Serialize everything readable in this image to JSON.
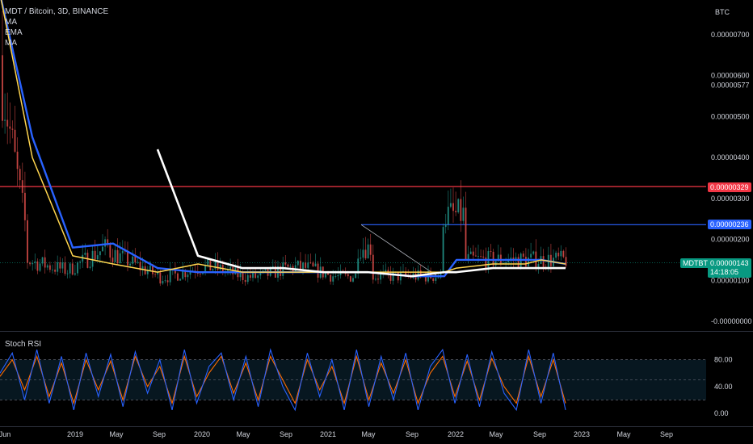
{
  "header": {
    "symbol_line": "MDT / Bitcoin, 3D, BINANCE",
    "indicators": [
      "MA",
      "EMA",
      "MA"
    ]
  },
  "currency": "BTC",
  "price_axis": {
    "ticks": [
      "0.00000700",
      "0.00000600",
      "0.00000577",
      "0.00000500",
      "0.00000400",
      "0.00000300",
      "0.00000200",
      "0.00000100",
      "-0.00000000"
    ]
  },
  "tags": {
    "red_level": "0.00000329",
    "blue_level": "0.00000236",
    "last_symbol": "MDTBTC",
    "last_price": "0.00000143",
    "countdown": "14:18:05"
  },
  "time_axis": {
    "labels": [
      "Jun",
      "2019",
      "May",
      "Sep",
      "2020",
      "May",
      "Sep",
      "2021",
      "May",
      "Sep",
      "2022",
      "May",
      "Sep",
      "2023",
      "May",
      "Sep"
    ]
  },
  "stoch": {
    "title": "Stoch RSI",
    "ticks": [
      "80.00",
      "40.00",
      "0.00"
    ]
  },
  "colors": {
    "background": "#000000",
    "red_line": "#f23645",
    "blue_line": "#2962ff",
    "ma_blue": "#2962ff",
    "ema_yellow": "#ffd54f",
    "ma_white": "#ffffff",
    "candle_up": "#26a69a",
    "candle_down": "#ef5350",
    "last_price_tag": "#089981",
    "stoch_k": "#2962ff",
    "stoch_d": "#ff6d00",
    "stoch_band": "#0d2a3a"
  },
  "chart_data": [
    {
      "type": "line",
      "title": "MDT / Bitcoin, 3D, BINANCE",
      "ylabel": "BTC",
      "ylim": [
        0,
        7.5e-06
      ],
      "horizontal_levels": [
        3.29e-06,
        2.36e-06
      ],
      "last_price": 1.43e-06,
      "x": [
        "2018-06",
        "2018-09",
        "2019-01",
        "2019-05",
        "2019-09",
        "2020-01",
        "2020-05",
        "2020-09",
        "2021-01",
        "2021-04",
        "2021-05",
        "2021-09",
        "2021-12",
        "2022-01",
        "2022-05",
        "2022-08",
        "2022-09",
        "2022-11"
      ],
      "series": [
        {
          "name": "MA",
          "values": [
            8e-06,
            4.5e-06,
            1.8e-06,
            1.9e-06,
            1.3e-06,
            1.2e-06,
            1.2e-06,
            1.2e-06,
            1.2e-06,
            1.2e-06,
            1.2e-06,
            1.1e-06,
            1.1e-06,
            1.5e-06,
            1.5e-06,
            1.5e-06,
            1.5e-06,
            1.4e-06
          ]
        },
        {
          "name": "EMA",
          "values": [
            8e-06,
            4e-06,
            1.6e-06,
            1.4e-06,
            1.2e-06,
            1.4e-06,
            1.2e-06,
            1.2e-06,
            1.2e-06,
            1.2e-06,
            1.2e-06,
            1.2e-06,
            1.2e-06,
            1.3e-06,
            1.4e-06,
            1.4e-06,
            1.5e-06,
            1.4e-06
          ]
        },
        {
          "name": "MA",
          "values": [
            null,
            null,
            null,
            null,
            4.2e-06,
            1.6e-06,
            1.3e-06,
            1.3e-06,
            1.2e-06,
            1.2e-06,
            1.2e-06,
            1.1e-06,
            1.2e-06,
            1.2e-06,
            1.3e-06,
            1.3e-06,
            1.3e-06,
            1.3e-06
          ]
        }
      ]
    },
    {
      "type": "line",
      "title": "Stoch RSI",
      "ylim": [
        0,
        100
      ],
      "bands": [
        20,
        80
      ],
      "series": [
        {
          "name": "K",
          "values": [
            60,
            90,
            20,
            95,
            15,
            85,
            5,
            90,
            25,
            88,
            10,
            92,
            30,
            80,
            5,
            95,
            15,
            70,
            90,
            20,
            85,
            10,
            95,
            40,
            5,
            90,
            25,
            80,
            5,
            95,
            10,
            85,
            20,
            90,
            5,
            70,
            95,
            15,
            88,
            10,
            92,
            30,
            5,
            95,
            15,
            90,
            5
          ]
        },
        {
          "name": "D",
          "values": [
            55,
            80,
            35,
            85,
            25,
            75,
            15,
            80,
            35,
            78,
            20,
            85,
            40,
            70,
            15,
            85,
            25,
            60,
            85,
            30,
            75,
            20,
            85,
            50,
            15,
            80,
            35,
            70,
            15,
            85,
            20,
            75,
            30,
            80,
            15,
            60,
            85,
            25,
            78,
            20,
            82,
            40,
            15,
            85,
            25,
            80,
            15
          ]
        }
      ]
    }
  ]
}
